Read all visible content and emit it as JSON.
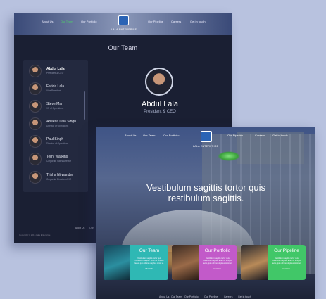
{
  "team_page": {
    "nav": {
      "left_links": [
        "About Us",
        "Our Team",
        "Our Portfolio"
      ],
      "right_links": [
        "Our Pipeline",
        "Careers",
        "Get in touch"
      ],
      "logo_text": "LALA ENTERPRISE"
    },
    "title": "Our Team",
    "members": [
      {
        "name": "Abdul Lala",
        "role": "President & CEO"
      },
      {
        "name": "Farida Lala",
        "role": "Vice President"
      },
      {
        "name": "Steve Man",
        "role": "VP of Operations"
      },
      {
        "name": "Aneesa Lala Singh",
        "role": "Director of Operations"
      },
      {
        "name": "Paul Singh",
        "role": "Director of Operations"
      },
      {
        "name": "Terry Watkins",
        "role": "Corporate Sales Director"
      },
      {
        "name": "Trisha Nirwander",
        "role": "Corporate Director of HR"
      }
    ],
    "featured": {
      "name": "Abdul Lala",
      "role": "President & CEO"
    },
    "footer_links": [
      "About Us",
      "Our"
    ],
    "copyright": "Copyright © 2015 Lala Enterprise"
  },
  "landing_page": {
    "nav": {
      "left_links": [
        "About Us",
        "Our Team",
        "Our Portfolio"
      ],
      "right_links": [
        "Our Pipeline",
        "Careers",
        "Get in touch"
      ],
      "logo_text": "LALA ENTERPRISE"
    },
    "hero": {
      "line1": "Vestibulum sagittis tortor quis",
      "line2": "restibulum sagittis."
    },
    "cards": [
      {
        "title": "Our Team",
        "text": "Vestibulum sagittis tortor quis restibulum sagittis. Etiam id tempus lacus, quis ultrices dapibus tortor ut.",
        "more": "MORE",
        "color": "#2fb8b4"
      },
      {
        "title": "Our Portfolio",
        "text": "Vestibulum sagittis tortor quis restibulum sagittis. Etiam id tempus lacus, quis ultrices dapibus tortor ut.",
        "more": "MORE",
        "color": "#c25ac9"
      },
      {
        "title": "Our Pipeline",
        "text": "Vestibulum sagittis tortor quis restibulum sagittis. Etiam id tempus lacus, quis ultrices dapibus tortor ut.",
        "more": "MORE",
        "color": "#41c768"
      }
    ],
    "footer_links": [
      "About Us",
      "Our Team",
      "Our Portfolio",
      "Our Pipeline",
      "Careers",
      "Get in touch"
    ]
  }
}
